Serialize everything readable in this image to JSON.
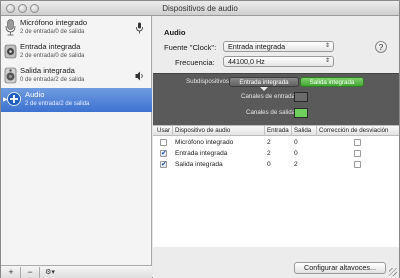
{
  "window": {
    "title": "Dispositivos de audio"
  },
  "sidebar": {
    "devices": [
      {
        "name": "Micrófono integrado",
        "channels": "2 de entrada/0 de salida",
        "icon": "microphone-icon",
        "right_icon": "microphone-small-icon",
        "selected": false
      },
      {
        "name": "Entrada integrada",
        "channels": "2 de entrada/0 de salida",
        "icon": "line-in-icon",
        "right_icon": "",
        "selected": false
      },
      {
        "name": "Salida integrada",
        "channels": "0 de entrada/2 de salida",
        "icon": "speaker-icon",
        "right_icon": "speaker-small-icon",
        "selected": false
      },
      {
        "name": "Audio",
        "channels": "2 de entrada/2 de salida",
        "icon": "aggregate-plus-icon",
        "right_icon": "",
        "selected": true
      }
    ],
    "bottom": {
      "add": "+",
      "remove": "−",
      "gear": "⚙▾"
    }
  },
  "main": {
    "section_title": "Audio",
    "clock_label": "Fuente \"Clock\":",
    "clock_value": "Entrada integrada",
    "help": "?",
    "freq_label": "Frecuencia:",
    "freq_value": "44100,0 Hz",
    "subdevices_label": "Subdispositivos:",
    "subdevice_entrada": "Entrada integrada",
    "subdevice_salida": "Salida integrada",
    "input_channels_label": "Canales de entrada:",
    "output_channels_label": "Canales de salida:",
    "table": {
      "headers": [
        "Usar",
        "Dispositivo de audio",
        "Entrada",
        "Salida",
        "Corrección de desviación"
      ],
      "rows": [
        {
          "use": false,
          "device": "Micrófono integrado",
          "in": "2",
          "out": "0",
          "drift": false
        },
        {
          "use": true,
          "device": "Entrada integrada",
          "in": "2",
          "out": "0",
          "drift": false
        },
        {
          "use": true,
          "device": "Salida integrada",
          "in": "0",
          "out": "2",
          "drift": false
        }
      ]
    },
    "config_button": "Configurar altavoces..."
  },
  "colors": {
    "selection": "#3d72cf",
    "green_pill": "#45a435",
    "sub_panel": "#5a5a5a"
  }
}
